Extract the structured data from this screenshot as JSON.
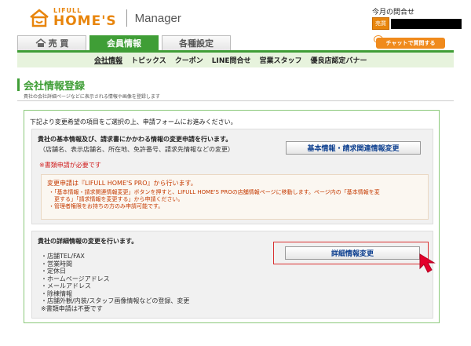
{
  "header": {
    "logo_small": "LIFULL",
    "logo_big": "HOME'S",
    "manager": "Manager",
    "today_label": "今月の問合せ",
    "today_badge": "売買"
  },
  "tabs": [
    {
      "label": "売 買"
    },
    {
      "label": "会員情報"
    },
    {
      "label": "各種設定"
    }
  ],
  "chat_button": "チャットで質問する",
  "subnav": [
    {
      "label": "会社情報"
    },
    {
      "label": "トピックス"
    },
    {
      "label": "クーポン"
    },
    {
      "label": "LINE問合せ"
    },
    {
      "label": "営業スタッフ"
    },
    {
      "label": "優良店認定バナー"
    }
  ],
  "page": {
    "title": "会社情報登録",
    "subtitle": "貴社の会社詳細ページなどに表示される情報や画像を登録します"
  },
  "intro": "下記より変更希望の項目をご選択の上、申請フォームにお進みください。",
  "basic_section": {
    "title": "貴社の基本情報及び、請求書にかかわる情報の変更申請を行います。",
    "sub": "（店舗名、表示店舗名、所在地、免許番号、請求先情報などの変更）",
    "required": "※書類申請が必要です",
    "button": "基本情報・請求関連情報変更",
    "notice_title": "変更申請は『LIFULL HOME'S PRO』から行います。",
    "notice_lines": [
      "・「基本情報・請求関連情報変更」ボタンを押すと、LIFULL HOME'S PROの店舗情報ページに移動します。ページ内の「基本情報を変",
      "　更する」「請求情報を変更する」から申請ください。",
      "・管理者権限をお持ちの方のみ申請可能です。"
    ]
  },
  "detail_section": {
    "title": "貴社の詳細情報の変更を行います。",
    "button": "詳細情報変更",
    "items": [
      "・店舗TEL/FAX",
      "・営業時間",
      "・定休日",
      "・ホームページアドレス",
      "・メールアドレス",
      "・除棟情報",
      "・店舗外観/内装/スタッフ画像情報などの登録、変更",
      "※書類申請は不要です"
    ]
  },
  "colors": {
    "brand_orange": "#e8850c",
    "green": "#3f9e36",
    "link_blue": "#0d3f8f",
    "red": "#d12020"
  }
}
